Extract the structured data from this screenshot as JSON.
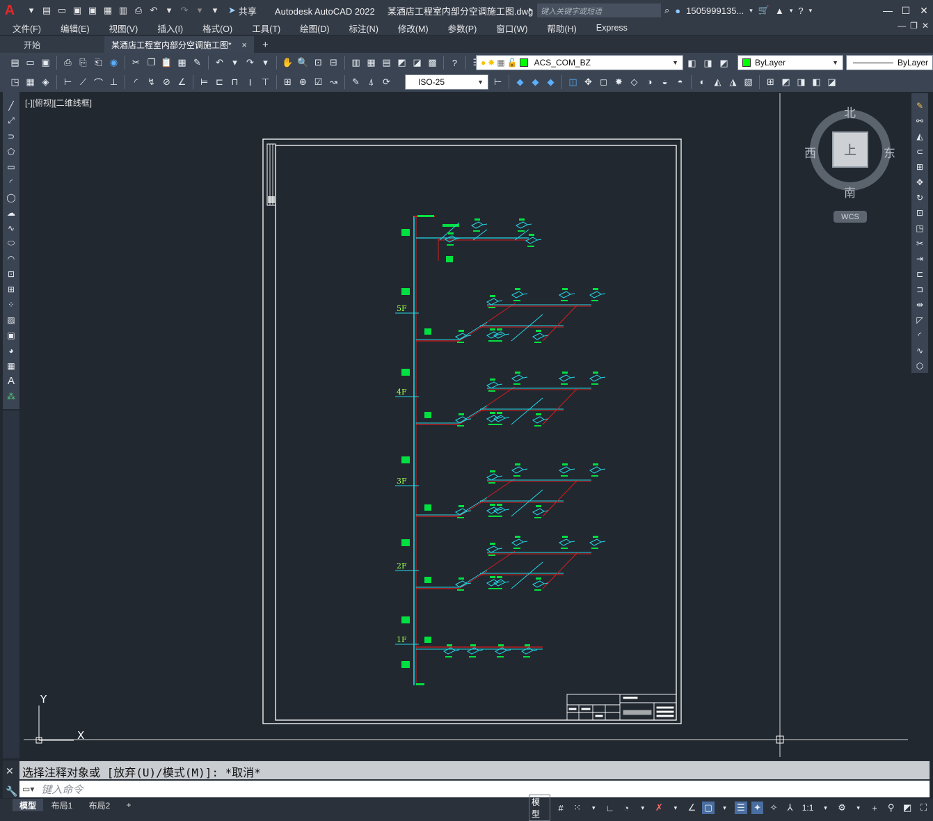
{
  "titlebar": {
    "app_name": "Autodesk AutoCAD 2022",
    "file_name": "某酒店工程室内部分空调施工图.dwg",
    "share_label": "共享",
    "search_placeholder": "键入关键字或短语",
    "user": "1505999135...",
    "logo": "A"
  },
  "menu": {
    "items": [
      "文件(F)",
      "编辑(E)",
      "视图(V)",
      "插入(I)",
      "格式(O)",
      "工具(T)",
      "绘图(D)",
      "标注(N)",
      "修改(M)",
      "参数(P)",
      "窗口(W)",
      "帮助(H)",
      "Express"
    ]
  },
  "tabs": {
    "start": "开始",
    "active": "某酒店工程室内部分空调施工图*",
    "close": "×",
    "add": "+"
  },
  "toolbar": {
    "layer_name": "ACS_COM_BZ",
    "color_value": "ByLayer",
    "linetype_value": "ByLayer",
    "dimstyle_value": "ISO-25"
  },
  "viewport": {
    "label": "[-][俯视][二维线框]"
  },
  "viewcube": {
    "north": "北",
    "south": "南",
    "east": "东",
    "west": "西",
    "face": "上",
    "wcs": "WCS"
  },
  "ucs": {
    "y": "Y",
    "x": "X"
  },
  "drawing": {
    "floors": [
      "5F",
      "4F",
      "3F",
      "2F",
      "1F"
    ]
  },
  "command": {
    "history": "选择注释对象或 [放弃(U)/模式(M)]: *取消*",
    "input_placeholder": "键入命令"
  },
  "status": {
    "model_tab": "模型",
    "layout1": "布局1",
    "layout2": "布局2",
    "add": "+",
    "model_button": "模型",
    "scale": "1:1"
  },
  "colors": {
    "pipe_red": "#d81c1c",
    "pipe_cyan": "#24d7e6",
    "tag_green": "#00e040",
    "frame_white": "#ffffff",
    "canvas_bg": "#212830"
  }
}
